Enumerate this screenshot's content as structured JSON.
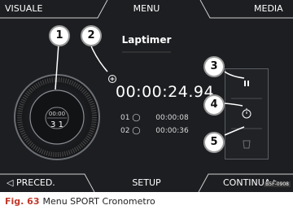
{
  "top_tabs": [
    "VISUALE",
    "MENU",
    "MEDIA"
  ],
  "title": "Laptimer",
  "dial": {
    "top": "00:00",
    "bottom": "3 1"
  },
  "timer": {
    "main": "00:00:24.94"
  },
  "laps": [
    {
      "number": "01",
      "time": "00:00:08"
    },
    {
      "number": "02",
      "time": "00:00:36"
    }
  ],
  "callouts": [
    "1",
    "2",
    "3",
    "4",
    "5"
  ],
  "bottom_tabs": [
    "PRECED.",
    "SETUP",
    "CONTINUA"
  ],
  "image_code": "B5F-0908",
  "caption": {
    "fig": "Fig. 63",
    "text": "Menu SPORT Cronometro"
  },
  "colors": {
    "background": "#1c1e21",
    "text": "#ffffff",
    "caption_accent": "#c0392b"
  }
}
